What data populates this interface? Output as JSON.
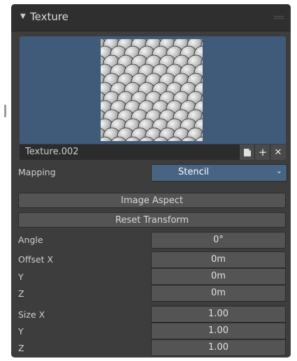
{
  "panel": {
    "title": "Texture",
    "collapse_icon": "disclosure-triangle-down",
    "grip_icon": "drag-grip-dots"
  },
  "texture": {
    "name": "Texture.002",
    "buttons": [
      {
        "icon": "new-file-icon",
        "glyph": ""
      },
      {
        "icon": "plus-icon",
        "glyph": "+"
      },
      {
        "icon": "close-icon",
        "glyph": "✕"
      }
    ]
  },
  "mapping": {
    "label": "Mapping",
    "value": "Stencil",
    "dropdown_icon": "chevron-down-icon"
  },
  "buttons": {
    "image_aspect": "Image Aspect",
    "reset_transform": "Reset Transform"
  },
  "fields": {
    "angle": {
      "label": "Angle",
      "value": "0°"
    },
    "offset": [
      {
        "label": "Offset X",
        "value": "0m"
      },
      {
        "label": "Y",
        "value": "0m"
      },
      {
        "label": "Z",
        "value": "0m"
      }
    ],
    "size": [
      {
        "label": "Size X",
        "value": "1.00"
      },
      {
        "label": "Y",
        "value": "1.00"
      },
      {
        "label": "Z",
        "value": "1.00"
      }
    ]
  },
  "colors": {
    "panel_bg": "#3d3d3d",
    "header_bg": "#2f2f2f",
    "preview_bg": "#405a7a",
    "accent_dropdown": "#476483",
    "field_bg": "#545454"
  }
}
